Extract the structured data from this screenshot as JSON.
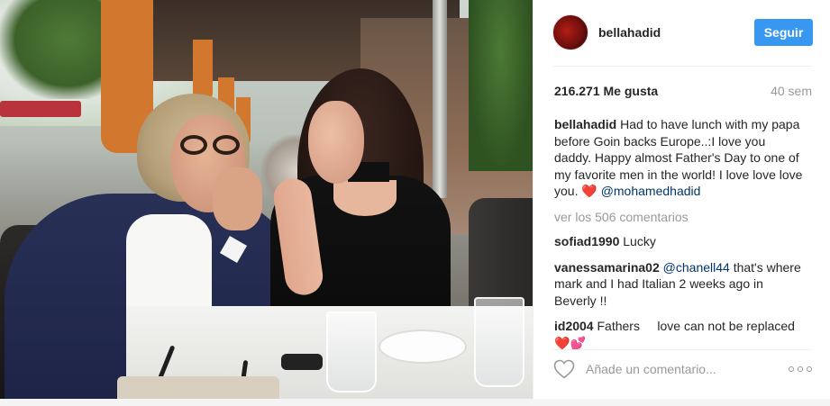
{
  "post": {
    "author": {
      "username": "bellahadid",
      "follow_label": "Seguir",
      "avatar_icon": "profile-avatar"
    },
    "likes": "216.271 Me gusta",
    "time_ago": "40 sem",
    "caption": {
      "user": "bellahadid",
      "text": "Had to have lunch with my papa before Goin backs Europe..:I love you daddy. Happy almost Father's Day to one of my favorite men in the world! I love love love you.",
      "heart": "❤️",
      "mention": "@mohamedhadid"
    },
    "view_all_comments": "ver los 506 comentarios",
    "comments": [
      {
        "user": "sofiad1990",
        "text": "Lucky"
      },
      {
        "user": "vanessamarina02",
        "mention": "@chanell44",
        "text": "that's where mark and I had Italian 2 weeks ago in Beverly !!"
      },
      {
        "user": "id2004",
        "text": "Fathers     love can not be replaced",
        "emoji_heart": "❤️",
        "emoji_hearts": "💕"
      }
    ],
    "add_comment_placeholder": "Añade un comentario...",
    "icons": {
      "like": "heart-outline-icon",
      "more": "more-options-icon"
    },
    "colors": {
      "follow_button": "#3897f0",
      "mention": "#003569",
      "muted": "#999999",
      "text": "#262626"
    }
  }
}
